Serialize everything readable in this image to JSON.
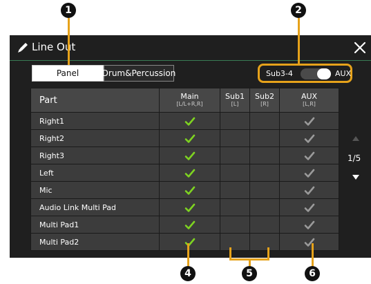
{
  "window": {
    "title": "Line Out",
    "close_icon": "close-icon",
    "title_icon": "pen-icon"
  },
  "tabs": [
    {
      "label": "Panel",
      "selected": true
    },
    {
      "label": "Drum&Percussion",
      "selected": false
    }
  ],
  "output_toggle": {
    "left_label": "Sub3-4",
    "right_label": "AUX",
    "state": "AUX"
  },
  "table": {
    "header": {
      "part": "Part",
      "main": "Main",
      "main_sub": "[L/L+R,R]",
      "sub1": "Sub1",
      "sub1_sub": "[L]",
      "sub2": "Sub2",
      "sub2_sub": "[R]",
      "aux": "AUX",
      "aux_sub": "[L,R]"
    },
    "rows": [
      {
        "part": "Right1",
        "main": true,
        "sub1": false,
        "sub2": false,
        "aux": true
      },
      {
        "part": "Right2",
        "main": true,
        "sub1": false,
        "sub2": false,
        "aux": true
      },
      {
        "part": "Right3",
        "main": true,
        "sub1": false,
        "sub2": false,
        "aux": true
      },
      {
        "part": "Left",
        "main": true,
        "sub1": false,
        "sub2": false,
        "aux": true
      },
      {
        "part": "Mic",
        "main": true,
        "sub1": false,
        "sub2": false,
        "aux": true
      },
      {
        "part": "Audio Link Multi Pad",
        "main": true,
        "sub1": false,
        "sub2": false,
        "aux": true
      },
      {
        "part": "Multi Pad1",
        "main": true,
        "sub1": false,
        "sub2": false,
        "aux": true
      },
      {
        "part": "Multi Pad2",
        "main": true,
        "sub1": false,
        "sub2": false,
        "aux": true
      }
    ]
  },
  "pagination": {
    "indicator": "1/5"
  },
  "callouts": [
    "1",
    "2",
    "4",
    "5",
    "6"
  ],
  "colors": {
    "main_check": "#7ed321",
    "aux_check": "#9a9a9a",
    "highlight": "#e6a21a",
    "title_rule": "#3a7d55"
  }
}
